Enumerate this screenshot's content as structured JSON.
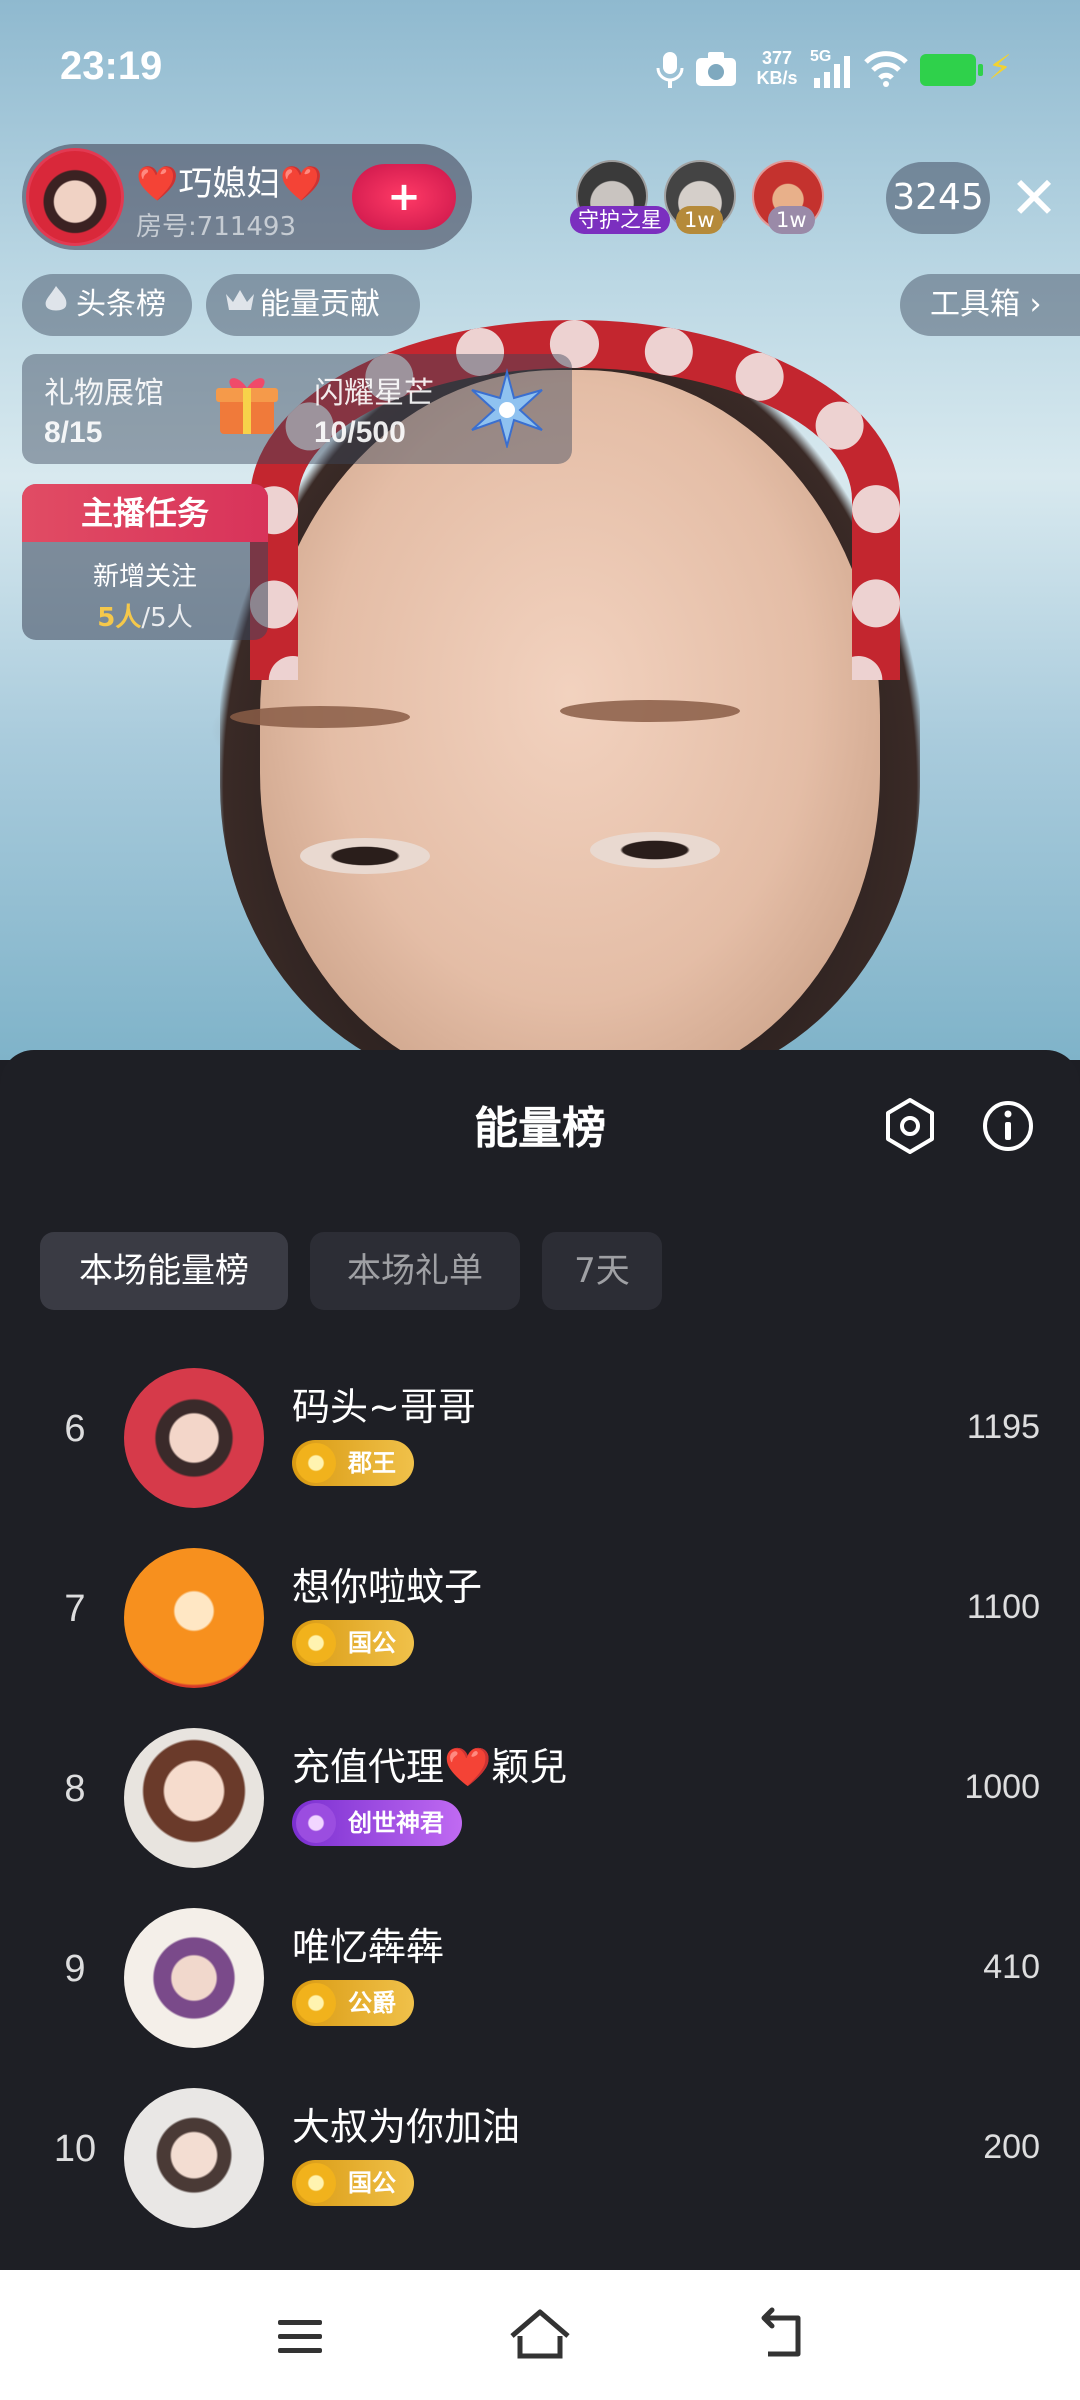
{
  "status_bar": {
    "time": "23:19",
    "net_speed_value": "377",
    "net_speed_unit": "KB/s",
    "network": "5G"
  },
  "host": {
    "name": "❤️巧媳妇❤️",
    "room_id": "房号:711493",
    "follow_label": "+"
  },
  "audience": {
    "badges": [
      "守护之星",
      "1w",
      "1w"
    ],
    "viewer_count": "3245",
    "close_label": "✕"
  },
  "pills": {
    "headline_rank": "头条榜",
    "energy_contribution": "能量贡献",
    "toolbox": "工具箱 ›"
  },
  "progress": {
    "gift_label": "礼物展馆",
    "gift_value": "8/15",
    "star_label": "闪耀星芒",
    "star_value": "10/500"
  },
  "task": {
    "title": "主播任务",
    "description": "新增关注",
    "done": "5人",
    "total": "/5人"
  },
  "sheet": {
    "title": "能量榜",
    "tabs": [
      "本场能量榜",
      "本场礼单",
      "7天"
    ],
    "active_tab": 0,
    "rows": [
      {
        "rank": "6",
        "name": "码头~哥哥",
        "badge": "郡王",
        "score": "1195"
      },
      {
        "rank": "7",
        "name": "想你啦蚊子",
        "badge": "国公",
        "score": "1100"
      },
      {
        "rank": "8",
        "name": "充值代理❤️颖兒",
        "badge": "创世神君",
        "score": "1000"
      },
      {
        "rank": "9",
        "name": "唯忆犇犇",
        "badge": "公爵",
        "score": "410"
      },
      {
        "rank": "10",
        "name": "大叔为你加油",
        "badge": "国公",
        "score": "200"
      }
    ]
  },
  "colors": {
    "sheet_bg": "#1e1f25",
    "gold_badge": "#e0a21c",
    "purple_badge": "#8b3fd6",
    "task_red": "#e14c64"
  }
}
